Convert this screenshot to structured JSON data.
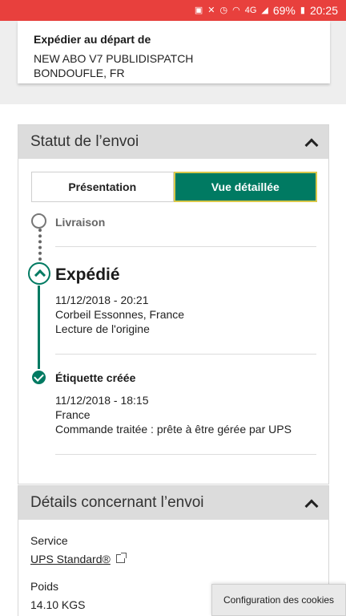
{
  "statusbar": {
    "battery": "69%",
    "time": "20:25",
    "network": "4G"
  },
  "origin": {
    "title": "Expédier au départ de",
    "line1": "NEW ABO V7 PUBLIDISPATCH",
    "line2": "BONDOUFLE, FR"
  },
  "status_section": {
    "title": "Statut de l’envoi",
    "tabs": [
      {
        "label": "Présentation",
        "active": false
      },
      {
        "label": "Vue détaillée",
        "active": true
      }
    ],
    "events": [
      {
        "title": "Livraison",
        "lines": []
      },
      {
        "title": "Expédié",
        "lines": [
          "11/12/2018 - 20:21",
          "Corbeil Essonnes, France",
          "Lecture de l'origine"
        ]
      },
      {
        "title": "Étiquette créée",
        "lines": [
          "11/12/2018 - 18:15",
          "France",
          "Commande traitée : prête à être gérée par UPS"
        ]
      }
    ]
  },
  "details_section": {
    "title": "Détails concernant l’envoi",
    "service_label": "Service",
    "service_value": "UPS Standard®",
    "weight_label": "Poids",
    "weight_value": "14.10 KGS"
  },
  "cookie_button": "Configuration des cookies",
  "colors": {
    "statusbar": "#e8403d",
    "accent": "#007a62",
    "active_border": "#d9c84a"
  }
}
